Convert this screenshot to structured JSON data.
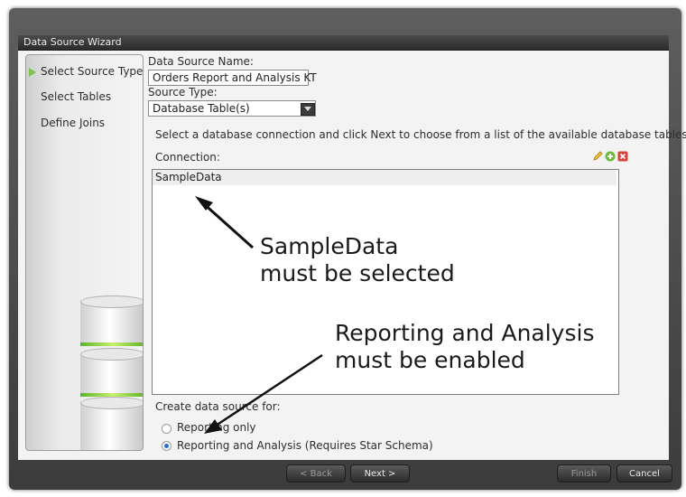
{
  "window": {
    "title": "Data Source Wizard"
  },
  "sidebar": {
    "items": [
      {
        "label": "Select Source Type",
        "active": true
      },
      {
        "label": "Select Tables",
        "active": false
      },
      {
        "label": "Define Joins",
        "active": false
      }
    ],
    "illustration_icon": "database-stack-icon"
  },
  "form": {
    "name_label": "Data Source Name:",
    "name_value": "Orders Report and Analysis KT",
    "type_label": "Source Type:",
    "type_value": "Database Table(s)",
    "instruction": "Select a database connection and click Next to choose from a list of the available database tables.",
    "connection_label": "Connection:",
    "connection_icons": [
      "edit-pencil-icon",
      "add-icon",
      "delete-icon"
    ],
    "connections": [
      "SampleData"
    ],
    "create_for_label": "Create data source for:",
    "options": [
      {
        "label": "Reporting only",
        "selected": false
      },
      {
        "label": "Reporting and Analysis (Requires Star Schema)",
        "selected": true
      }
    ]
  },
  "annotations": {
    "note1_line1": "SampleData",
    "note1_line2": "must be selected",
    "note2_line1": "Reporting and Analysis",
    "note2_line2": "must be enabled"
  },
  "buttons": {
    "back": "< Back",
    "next": "Next >",
    "finish": "Finish",
    "cancel": "Cancel"
  },
  "colors": {
    "accent_green": "#7fc24b",
    "titlebar": "#2c2c2c"
  }
}
